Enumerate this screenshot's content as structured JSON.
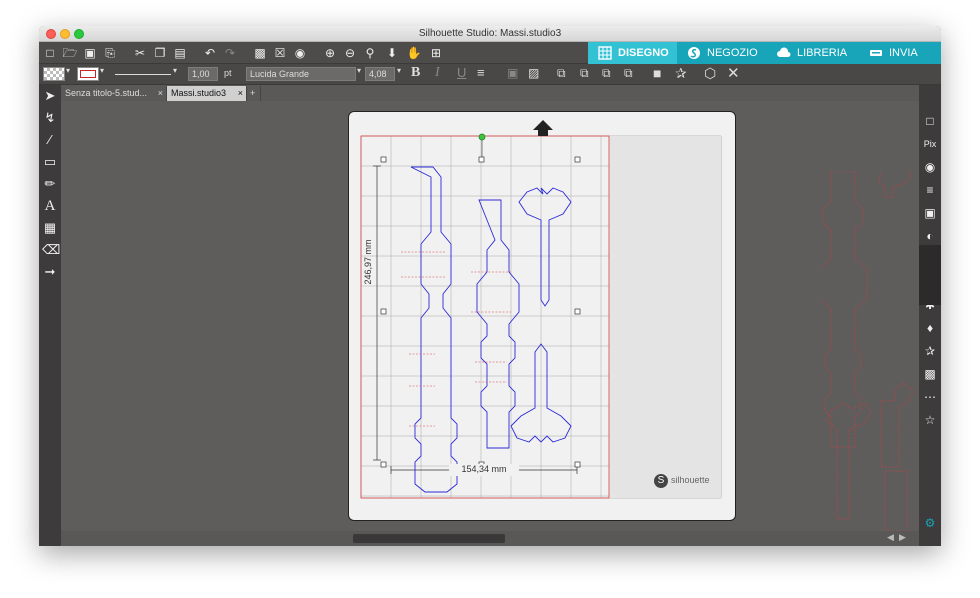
{
  "window": {
    "title": "Silhouette Studio: Massi.studio3"
  },
  "toolbar": {
    "line_width": "1,00",
    "line_unit": "pt",
    "font_name": "Lucida Grande",
    "font_size": "4,08"
  },
  "nav_tabs": [
    {
      "label": "DISEGNO",
      "active": true
    },
    {
      "label": "NEGOZIO",
      "active": false
    },
    {
      "label": "LIBRERIA",
      "active": false
    },
    {
      "label": "INVIA",
      "active": false
    }
  ],
  "doc_tabs": [
    {
      "label": "Senza titolo-5.stud...",
      "active": false
    },
    {
      "label": "Massi.studio3",
      "active": true
    }
  ],
  "canvas": {
    "height_dimension": "246,97 mm",
    "width_dimension": "154,34 mm",
    "brand_label": "silhouette"
  },
  "colors": {
    "accent": "#18a4b9",
    "accent_active": "#33c2d4",
    "cut_line": "#c62828",
    "shape_line": "#2a2ad6",
    "background": "#5f5c5c"
  }
}
